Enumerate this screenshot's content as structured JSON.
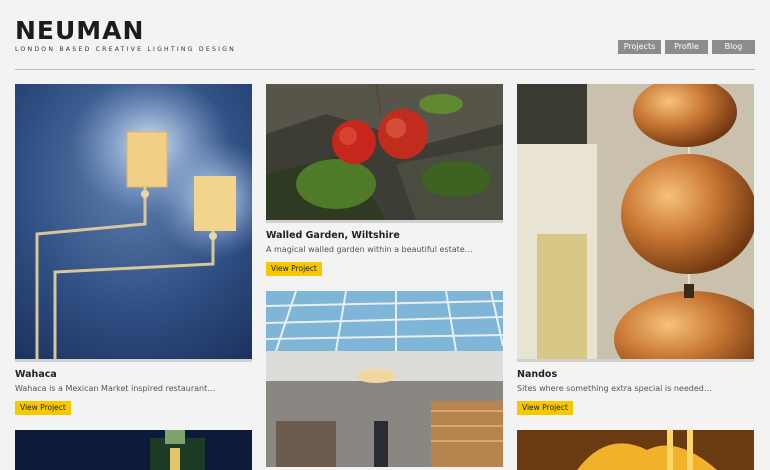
{
  "header": {
    "logo_title": "NEUMAN",
    "logo_subtitle": "LONDON BASED CREATIVE LIGHTING DESIGN"
  },
  "nav": {
    "items": [
      {
        "label": "Projects"
      },
      {
        "label": "Profile"
      },
      {
        "label": "Blog"
      }
    ]
  },
  "projects": [
    {
      "title": "Wahaca",
      "description": "Wahaca is a Mexican Market inspired restaurant…",
      "button": "View Project"
    },
    {
      "title": "Walled Garden, Wiltshire",
      "description": "A magical walled garden within a beautiful estate…",
      "button": "View Project"
    },
    {
      "title": "Nandos",
      "description": "Sites where something extra special is needed…",
      "button": "View Project"
    }
  ],
  "colors": {
    "background": "#f3f3f3",
    "nav_button": "#8c8c8c",
    "accent_button": "#f6c800"
  }
}
